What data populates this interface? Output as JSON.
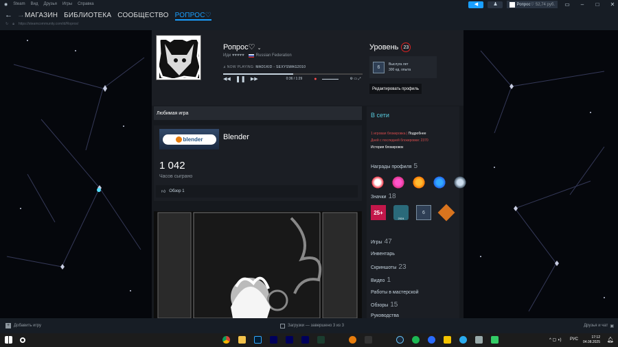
{
  "titlebar": {
    "menu": [
      "Steam",
      "Вид",
      "Друзья",
      "Игры",
      "Справка"
    ],
    "user": "Ропрос♡",
    "balance": "52,74 руб."
  },
  "nav": {
    "links": [
      "МАГАЗИН",
      "БИБЛИОТЕКА",
      "СООБЩЕСТВО",
      "РОПРОС♡"
    ],
    "url": "https://steamcommunity.com/id/Ropros/"
  },
  "profile": {
    "name": "Ропрос♡",
    "realname": "Иди ♥♥♥♥♥",
    "country": "Russian Federation",
    "now_playing_label": "NOW PLAYING:",
    "now_playing_track": "MAD1KID - SEXYSWAG2010",
    "progress": 0.5,
    "time": "0:36 / 1:29",
    "level_label": "Уровень",
    "level": "23",
    "years_badge": "6",
    "years_label": "Выслуга лет",
    "xp_label": "300 ед. опыта",
    "edit_button": "Редактировать профиль"
  },
  "favorite": {
    "header": "Любимая игра",
    "game": "Blender",
    "logo_text": "blender",
    "hours": "1 042",
    "hours_label": "Часов сыграно",
    "review": "Обзор 1"
  },
  "sidebar": {
    "status": "В сети",
    "ban_line1": "1 игровая блокировка |",
    "ban_more": "Подробнее",
    "ban_line2": "Дней с последней блокировки: 2370",
    "ban_line3": "История блокировок",
    "awards_label": "Награды профиля",
    "awards_count": "5",
    "badges_label": "Значки",
    "badges_count": "18",
    "badge_25": "25+",
    "badge_6": "6",
    "badge_year": "2024",
    "games_label": "Игры",
    "games_count": "47",
    "inventory_label": "Инвентарь",
    "screenshots_label": "Скриншоты",
    "screenshots_count": "23",
    "video_label": "Видео",
    "video_count": "1",
    "workshop_label": "Работы в мастерской",
    "reviews_label": "Обзоры",
    "reviews_count": "15",
    "guides_label": "Руководства"
  },
  "bottombar": {
    "add_game": "Добавить игру",
    "downloads": "Загрузки — завершено 3 из 3",
    "friends": "Друзья и чат"
  },
  "taskbar": {
    "lang": "РУС",
    "time": "17:12",
    "date": "04.08.2025"
  },
  "colors": {
    "accent": "#1a9fff",
    "online": "#57cbde",
    "level_ring": "#dd2222",
    "ban_red": "#d64c4c"
  }
}
